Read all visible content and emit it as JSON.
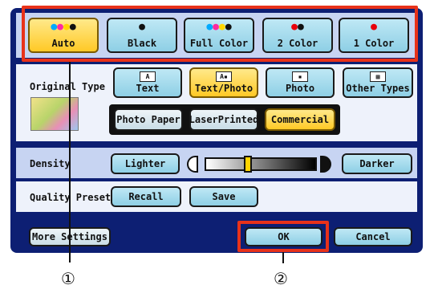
{
  "colormode": {
    "buttons": [
      {
        "label": "Auto",
        "dots": "●●●●",
        "selected": true
      },
      {
        "label": "Black",
        "dots": "●",
        "selected": false
      },
      {
        "label": "Full Color",
        "dots": "●●●●",
        "selected": false
      },
      {
        "label": "2 Color",
        "dots": "●●",
        "selected": false
      },
      {
        "label": "1 Color",
        "dots": "●",
        "selected": false
      }
    ]
  },
  "original_type": {
    "label": "Original Type",
    "types": [
      {
        "label": "Text",
        "icon": "text-doc-icon",
        "selected": false
      },
      {
        "label": "Text/Photo",
        "icon": "text-photo-doc-icon",
        "selected": true
      },
      {
        "label": "Photo",
        "icon": "photo-doc-icon",
        "selected": false
      },
      {
        "label": "Other Types",
        "icon": "other-types-icon",
        "selected": false
      }
    ],
    "subtypes": [
      {
        "label": "Photo Paper",
        "selected": false
      },
      {
        "label": "LaserPrinted",
        "selected": false
      },
      {
        "label": "Commercial",
        "selected": true
      }
    ]
  },
  "density": {
    "label": "Density",
    "lighter": "Lighter",
    "darker": "Darker",
    "level": 0.38
  },
  "quality": {
    "label": "Quality Presets",
    "recall": "Recall",
    "save": "Save"
  },
  "footer": {
    "more": "More Settings",
    "ok": "OK",
    "cancel": "Cancel"
  },
  "callouts": {
    "one": "①",
    "two": "②"
  },
  "colors": {
    "panel": "#0d1f73",
    "band": "#c7d4f2",
    "selected": "#ffc926",
    "unselected": "#8ecfe5",
    "highlight": "#e8321a"
  }
}
